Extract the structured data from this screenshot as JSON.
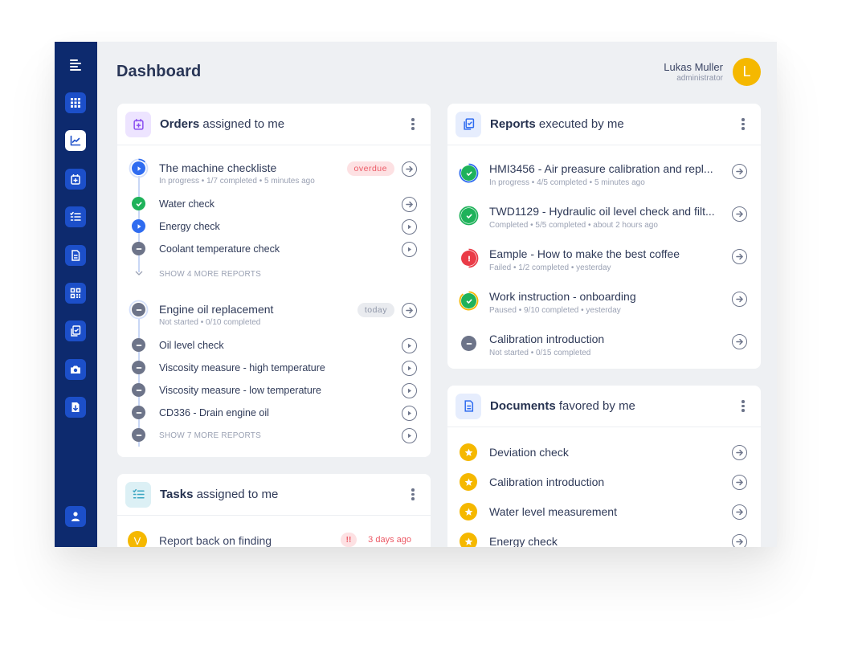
{
  "header": {
    "title": "Dashboard",
    "user": {
      "name": "Lukas Muller",
      "role": "administrator",
      "initial": "L"
    }
  },
  "sidebar": {
    "menu_icon": "menu-icon",
    "items": [
      {
        "name": "apps",
        "icon": "grid-icon",
        "active": false
      },
      {
        "name": "analytics",
        "icon": "chart-icon",
        "active": true
      },
      {
        "name": "orders",
        "icon": "calendar-plus-icon",
        "active": false
      },
      {
        "name": "tasks",
        "icon": "checklist-icon",
        "active": false
      },
      {
        "name": "documents",
        "icon": "document-icon",
        "active": false
      },
      {
        "name": "qr-codes",
        "icon": "qr-code-icon",
        "active": false
      },
      {
        "name": "reports",
        "icon": "copy-check-icon",
        "active": false
      },
      {
        "name": "camera",
        "icon": "camera-icon",
        "active": false
      },
      {
        "name": "downloads",
        "icon": "file-download-icon",
        "active": false
      },
      {
        "name": "profile",
        "icon": "user-icon",
        "active": false
      }
    ]
  },
  "orders": {
    "title_bold": "Orders",
    "title_rest": " assigned to me",
    "groups": [
      {
        "title": "The machine checkliste",
        "status": "In progress",
        "progress": "1/7 completed",
        "time": "5 minutes ago",
        "badge": "overdue",
        "items": [
          {
            "label": "Water check",
            "state": "completed",
            "action": "open"
          },
          {
            "label": "Energy check",
            "state": "in-progress",
            "action": "play"
          },
          {
            "label": "Coolant temperature check",
            "state": "not-started",
            "action": "play"
          }
        ],
        "more_label": "SHOW 4 MORE REPORTS"
      },
      {
        "title": "Engine oil replacement",
        "status": "Not started",
        "progress": "0/10 completed",
        "badge": "today",
        "items": [
          {
            "label": "Oil level check",
            "state": "not-started",
            "action": "play"
          },
          {
            "label": "Viscosity measure - high temperature",
            "state": "not-started",
            "action": "play"
          },
          {
            "label": "Viscosity measure - low temperature",
            "state": "not-started",
            "action": "play"
          },
          {
            "label": "CD336 - Drain engine oil",
            "state": "not-started",
            "action": "play"
          }
        ],
        "more_label": "SHOW 7 MORE REPORTS"
      }
    ]
  },
  "tasks": {
    "title_bold": "Tasks",
    "title_rest": " assigned to me",
    "items": [
      {
        "initial": "V",
        "title": "Report back on finding",
        "priority": "!!",
        "due": "3 days ago"
      }
    ]
  },
  "reports": {
    "title_bold": "Reports",
    "title_rest": " executed by me",
    "items": [
      {
        "title": "HMI3456 - Air preasure calibration and repl...",
        "sub": "In progress  •  4/5 completed  •  5 minutes ago",
        "state": "in-progress",
        "progress": 0.8
      },
      {
        "title": "TWD1129 - Hydraulic oil level check and filt...",
        "sub": "Completed  •  5/5 completed  •  about 2 hours ago",
        "state": "completed",
        "progress": 1.0
      },
      {
        "title": "Eample - How to make the best coffee",
        "sub": "Failed  •  1/2 completed  •  yesterday",
        "state": "failed",
        "progress": 0.5
      },
      {
        "title": "Work instruction - onboarding",
        "sub": "Paused  •  9/10 completed  •  yesterday",
        "state": "paused",
        "progress": 0.9
      },
      {
        "title": "Calibration introduction",
        "sub": "Not started  •  0/15 completed",
        "state": "not-started",
        "progress": 0
      }
    ]
  },
  "documents": {
    "title_bold": "Documents",
    "title_rest": " favored by me",
    "items": [
      {
        "title": "Deviation check"
      },
      {
        "title": "Calibration introduction"
      },
      {
        "title": "Water level measurement"
      },
      {
        "title": "Energy check"
      }
    ]
  },
  "colors": {
    "sidebar": "#0d2a6e",
    "sidebar_item": "#1c4fc9",
    "accent_yellow": "#f5b800",
    "blue": "#2f6cf0",
    "green": "#1fb25a",
    "red": "#ea3b47",
    "grey": "#6d7489"
  }
}
